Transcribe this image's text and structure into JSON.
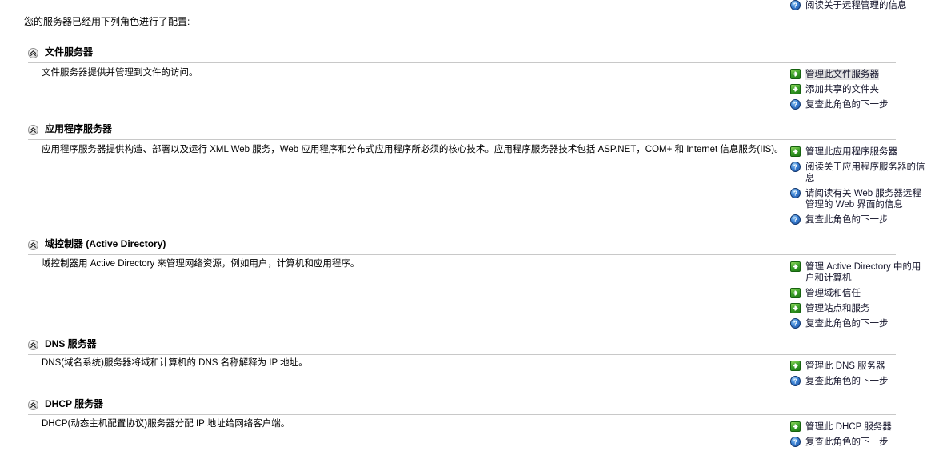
{
  "intro": "您的服务器已经用下列角色进行了配置:",
  "clipped_top_links": [
    {
      "icon": "help-icon",
      "label": "阅读关于远程管理的信息"
    }
  ],
  "icons": {
    "collapse": "chevron-double-up-icon",
    "arrow": "green-arrow-icon",
    "help": "blue-question-icon"
  },
  "colors": {
    "arrow_green": "#3da32a",
    "help_blue": "#3d84d6",
    "divider": "#c8c8c8",
    "text": "#000000",
    "link_text": "#14142b"
  },
  "sections": [
    {
      "title": "文件服务器",
      "description": "文件服务器提供并管理到文件的访问。",
      "links": [
        {
          "icon": "arrow",
          "label": "管理此文件服务器",
          "focused": true
        },
        {
          "icon": "arrow",
          "label": "添加共享的文件夹",
          "focused": false
        },
        {
          "icon": "help",
          "label": "复查此角色的下一步",
          "focused": false
        }
      ]
    },
    {
      "title": "应用程序服务器",
      "description": "应用程序服务器提供构造、部署以及运行 XML Web 服务，Web 应用程序和分布式应用程序所必须的核心技术。应用程序服务器技术包括 ASP.NET，COM+ 和 Internet 信息服务(IIS)。",
      "links": [
        {
          "icon": "arrow",
          "label": "管理此应用程序服务器",
          "focused": false
        },
        {
          "icon": "help",
          "label": "阅读关于应用程序服务器的信息",
          "focused": false
        },
        {
          "icon": "help",
          "label": "请阅读有关 Web 服务器远程管理的 Web 界面的信息",
          "focused": false
        },
        {
          "icon": "help",
          "label": "复查此角色的下一步",
          "focused": false
        }
      ]
    },
    {
      "title": "域控制器 (Active Directory)",
      "description": "域控制器用 Active Directory 来管理网络资源，例如用户，计算机和应用程序。",
      "links": [
        {
          "icon": "arrow",
          "label": "管理 Active Directory 中的用户和计算机",
          "focused": false
        },
        {
          "icon": "arrow",
          "label": "管理域和信任",
          "focused": false
        },
        {
          "icon": "arrow",
          "label": "管理站点和服务",
          "focused": false
        },
        {
          "icon": "help",
          "label": "复查此角色的下一步",
          "focused": false
        }
      ]
    },
    {
      "title": "DNS 服务器",
      "description": "DNS(域名系统)服务器将域和计算机的 DNS 名称解释为 IP 地址。",
      "links": [
        {
          "icon": "arrow",
          "label": "管理此 DNS 服务器",
          "focused": false
        },
        {
          "icon": "help",
          "label": "复查此角色的下一步",
          "focused": false
        }
      ]
    },
    {
      "title": "DHCP 服务器",
      "description": "DHCP(动态主机配置协议)服务器分配 IP 地址给网络客户端。",
      "links": [
        {
          "icon": "arrow",
          "label": "管理此 DHCP 服务器",
          "focused": false
        },
        {
          "icon": "help",
          "label": "复查此角色的下一步",
          "focused": false
        }
      ]
    }
  ],
  "layout": {
    "section_tops": [
      58,
      154,
      298,
      423,
      498
    ],
    "desc_tops": [
      84,
      180,
      323,
      447,
      523
    ],
    "link_tops": [
      86,
      183,
      327,
      451,
      527
    ]
  }
}
